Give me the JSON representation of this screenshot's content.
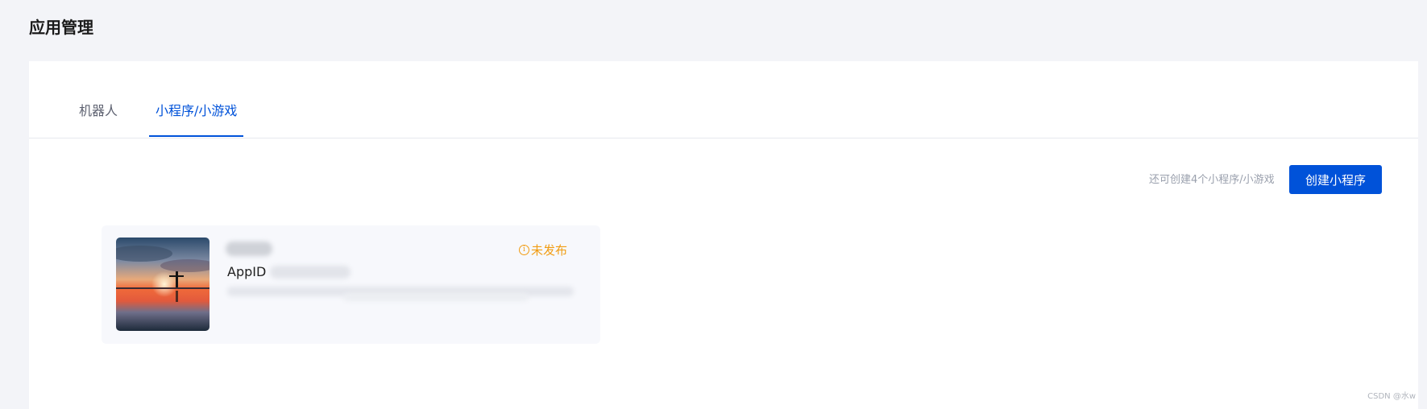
{
  "page": {
    "title": "应用管理"
  },
  "tabs": [
    {
      "label": "机器人",
      "active": false
    },
    {
      "label": "小程序/小游戏",
      "active": true
    }
  ],
  "toolbar": {
    "quota_text": "还可创建4个小程序/小游戏",
    "create_button_label": "创建小程序"
  },
  "app_card": {
    "appid_label": "AppID",
    "status_icon": "info-circle-icon",
    "status_glyph": "i",
    "status_text": "未发布"
  },
  "colors": {
    "background": "#f3f4f8",
    "accent": "#0052d9",
    "status_warning": "#f19c12",
    "card_background": "#f7f8fc"
  },
  "watermark": "CSDN @水w"
}
